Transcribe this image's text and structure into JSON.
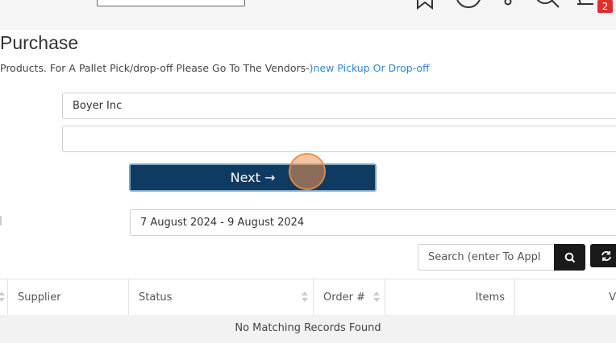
{
  "page": {
    "title": "Purchase",
    "intro_text": "Products. For A Pallet Pick/drop-off Please Go To The Vendors-",
    "intro_link": ")new Pickup Or Drop-off"
  },
  "header": {
    "icons": [
      "bookmark-icon",
      "help-icon",
      "account-icon",
      "search-icon",
      "cart-icon"
    ],
    "cart_count": "2"
  },
  "form": {
    "vendor_value": "Boyer Inc",
    "second_value": "",
    "next_label": "Next →",
    "date_range": "7 August 2024 - 9 August 2024"
  },
  "table_search": {
    "placeholder": "Search (enter To Appl"
  },
  "table": {
    "columns": [
      "Supplier",
      "Status",
      "Order #",
      "Items",
      "V"
    ],
    "empty_message": "No Matching Records Found"
  },
  "colors": {
    "primary_button": "#0f3b62",
    "link": "#2f86d4",
    "badge": "#dc2f2f"
  }
}
